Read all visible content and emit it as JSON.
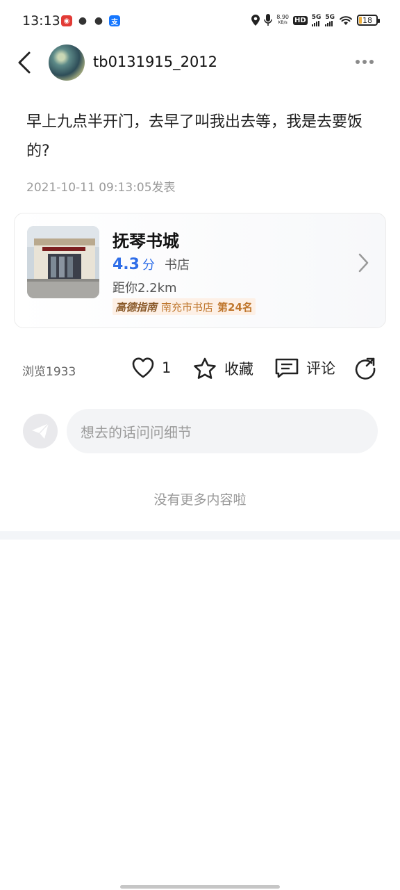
{
  "status_bar": {
    "time": "13:13",
    "net_speed_value": "8.90",
    "net_speed_unit": "KB/s",
    "hd_label": "HD",
    "sim1": "5G",
    "sim2": "5G",
    "battery": "18",
    "battery_level": 0.18,
    "app_icons": [
      "netease-music-icon",
      "wechat-icon",
      "message-icon",
      "alipay-icon"
    ]
  },
  "header": {
    "username": "tb0131915_2012"
  },
  "post": {
    "text": "早上九点半开门，去早了叫我出去等，我是去要饭的?",
    "date": "2021-10-11 09:13:05发表"
  },
  "poi": {
    "name": "抚琴书城",
    "score": "4.3",
    "score_unit": "分",
    "category": "书店",
    "distance": "距你2.2km",
    "rank_brand": "高德指南",
    "rank_list": "南充市书店",
    "rank_position": "第24名"
  },
  "actions": {
    "views": "浏览1933",
    "like_count": "1",
    "favorite_label": "收藏",
    "comment_label": "评论"
  },
  "comment_box": {
    "placeholder": "想去的话问问细节"
  },
  "footer": {
    "no_more": "没有更多内容啦"
  },
  "colors": {
    "accent_blue": "#2f6ee8",
    "rank_bg": "#fdf0e6",
    "rank_text": "#c0782f"
  }
}
